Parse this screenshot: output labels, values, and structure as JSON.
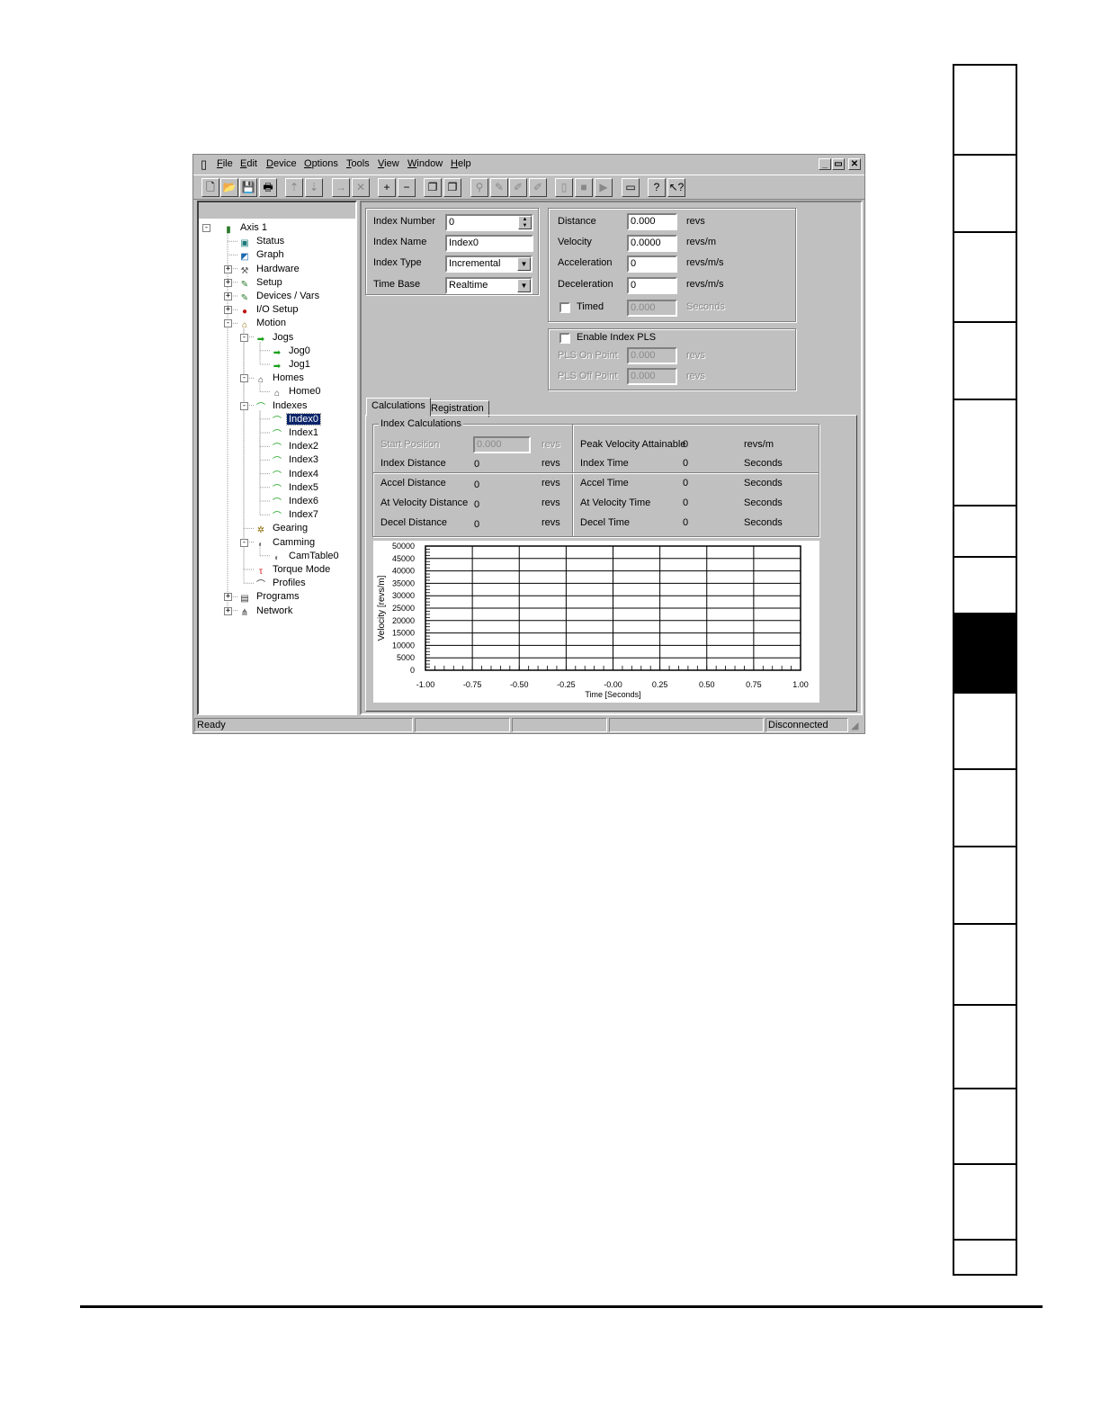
{
  "menu": {
    "items": [
      {
        "label": "File",
        "u": "F",
        "rest": "ile"
      },
      {
        "label": "Edit",
        "u": "E",
        "rest": "dit"
      },
      {
        "label": "Device",
        "u": "D",
        "rest": "evice"
      },
      {
        "label": "Options",
        "u": "O",
        "rest": "ptions"
      },
      {
        "label": "Tools",
        "u": "T",
        "rest": "ools"
      },
      {
        "label": "View",
        "u": "V",
        "rest": "iew"
      },
      {
        "label": "Window",
        "u": "W",
        "rest": "indow"
      },
      {
        "label": "Help",
        "u": "H",
        "rest": "elp"
      }
    ],
    "win_minimize": "_",
    "win_restore": "▭",
    "win_close": "✕"
  },
  "tree": {
    "nodes": [
      {
        "name": "tree-axis1",
        "label": "Axis 1",
        "icon": "axis-icon",
        "glyph": "▮",
        "color": "#2a7a2a"
      },
      {
        "name": "tree-status",
        "label": "Status",
        "icon": "status-icon",
        "glyph": "▣",
        "color": "#1d7a7a"
      },
      {
        "name": "tree-graph",
        "label": "Graph",
        "icon": "graph-icon",
        "glyph": "◩",
        "color": "#1d6ab0"
      },
      {
        "name": "tree-hardware",
        "label": "Hardware",
        "icon": "hardware-icon",
        "glyph": "⚒",
        "color": "#555"
      },
      {
        "name": "tree-setup",
        "label": "Setup",
        "icon": "setup-icon",
        "glyph": "✎",
        "color": "#2a7a2a"
      },
      {
        "name": "tree-devices-vars",
        "label": "Devices / Vars",
        "icon": "devices-icon",
        "glyph": "✎",
        "color": "#2a7a2a"
      },
      {
        "name": "tree-io-setup",
        "label": "I/O Setup",
        "icon": "io-setup-icon",
        "glyph": "●",
        "color": "#c01818"
      },
      {
        "name": "tree-motion",
        "label": "Motion",
        "icon": "motion-icon",
        "glyph": "⌂",
        "color": "#8a6a00"
      },
      {
        "name": "tree-jogs",
        "label": "Jogs",
        "icon": "jogs-icon",
        "glyph": "➡",
        "color": "#18a018"
      },
      {
        "name": "tree-jog0",
        "label": "Jog0",
        "icon": "jog-arrow-icon",
        "glyph": "➡",
        "color": "#18a018"
      },
      {
        "name": "tree-jog1",
        "label": "Jog1",
        "icon": "jog-arrow-icon",
        "glyph": "➡",
        "color": "#18a018"
      },
      {
        "name": "tree-homes",
        "label": "Homes",
        "icon": "home-icon",
        "glyph": "⌂",
        "color": "#333"
      },
      {
        "name": "tree-home0",
        "label": "Home0",
        "icon": "home-icon",
        "glyph": "⌂",
        "color": "#333"
      },
      {
        "name": "tree-indexes",
        "label": "Indexes",
        "icon": "index-profile-icon",
        "glyph": "⌒",
        "color": "#18a018"
      },
      {
        "name": "tree-index0",
        "label": "Index0",
        "icon": "index-profile-icon",
        "glyph": "⌒",
        "color": "#18a018"
      },
      {
        "name": "tree-index1",
        "label": "Index1",
        "icon": "index-profile-icon",
        "glyph": "⌒",
        "color": "#18a018"
      },
      {
        "name": "tree-index2",
        "label": "Index2",
        "icon": "index-profile-icon",
        "glyph": "⌒",
        "color": "#18a018"
      },
      {
        "name": "tree-index3",
        "label": "Index3",
        "icon": "index-profile-icon",
        "glyph": "⌒",
        "color": "#18a018"
      },
      {
        "name": "tree-index4",
        "label": "Index4",
        "icon": "index-profile-icon",
        "glyph": "⌒",
        "color": "#18a018"
      },
      {
        "name": "tree-index5",
        "label": "Index5",
        "icon": "index-profile-icon",
        "glyph": "⌒",
        "color": "#18a018"
      },
      {
        "name": "tree-index6",
        "label": "Index6",
        "icon": "index-profile-icon",
        "glyph": "⌒",
        "color": "#18a018"
      },
      {
        "name": "tree-index7",
        "label": "Index7",
        "icon": "index-profile-icon",
        "glyph": "⌒",
        "color": "#18a018"
      },
      {
        "name": "tree-gearing",
        "label": "Gearing",
        "icon": "gearing-icon",
        "glyph": "✲",
        "color": "#8a6a00"
      },
      {
        "name": "tree-camming",
        "label": "Camming",
        "icon": "camming-icon",
        "glyph": "◐",
        "color": "#777"
      },
      {
        "name": "tree-camtable0",
        "label": "CamTable0",
        "icon": "camtable-icon",
        "glyph": "◐",
        "color": "#777"
      },
      {
        "name": "tree-torque-mode",
        "label": "Torque Mode",
        "icon": "torque-icon",
        "glyph": "τ",
        "color": "#d01818"
      },
      {
        "name": "tree-profiles",
        "label": "Profiles",
        "icon": "profiles-icon",
        "glyph": "⌒",
        "color": "#333"
      },
      {
        "name": "tree-programs",
        "label": "Programs",
        "icon": "programs-icon",
        "glyph": "▤",
        "color": "#333"
      },
      {
        "name": "tree-network",
        "label": "Network",
        "icon": "network-icon",
        "glyph": "⋔",
        "color": "#333"
      }
    ],
    "selected": "Index0"
  },
  "index": {
    "number_label": "Index Number",
    "number_value": "0",
    "name_label": "Index Name",
    "name_value": "Index0",
    "type_label": "Index Type",
    "type_value": "Incremental",
    "timebase_label": "Time Base",
    "timebase_value": "Realtime"
  },
  "motion": {
    "distance_label": "Distance",
    "distance_value": "0.000",
    "distance_unit": "revs",
    "velocity_label": "Velocity",
    "velocity_value": "0.0000",
    "velocity_unit": "revs/m",
    "accel_label": "Acceleration",
    "accel_value": "0",
    "accel_unit": "revs/m/s",
    "decel_label": "Deceleration",
    "decel_value": "0",
    "decel_unit": "revs/m/s",
    "timed_label": "Timed",
    "timed_value": "0.000",
    "timed_unit": "Seconds"
  },
  "pls": {
    "enable_label": "Enable Index PLS",
    "on_label": "PLS On Point",
    "on_value": "0.000",
    "on_unit": "revs",
    "off_label": "PLS Off Point",
    "off_value": "0.000",
    "off_unit": "revs"
  },
  "tabs": {
    "calculations": "Calculations",
    "registration": "Registration"
  },
  "calc": {
    "group_title": "Index Calculations",
    "start_label": "Start Position",
    "start_value": "0.000",
    "start_unit": "revs",
    "index_dist_label": "Index Distance",
    "index_dist_value": "0",
    "index_dist_unit": "revs",
    "accel_dist_label": "Accel Distance",
    "accel_dist_value": "0",
    "accel_dist_unit": "revs",
    "atvel_dist_label": "At Velocity Distance",
    "atvel_dist_value": "0",
    "atvel_dist_unit": "revs",
    "decel_dist_label": "Decel Distance",
    "decel_dist_value": "0",
    "decel_dist_unit": "revs",
    "peak_label": "Peak Velocity Attainable",
    "peak_value": "0",
    "peak_unit": "revs/m",
    "index_time_label": "Index Time",
    "index_time_value": "0",
    "index_time_unit": "Seconds",
    "accel_time_label": "Accel Time",
    "accel_time_value": "0",
    "accel_time_unit": "Seconds",
    "atvel_time_label": "At Velocity Time",
    "atvel_time_value": "0",
    "atvel_time_unit": "Seconds",
    "decel_time_label": "Decel Time",
    "decel_time_value": "0",
    "decel_time_unit": "Seconds"
  },
  "chart_data": {
    "type": "line",
    "xlabel": "Time [Seconds]",
    "ylabel": "Velocity [revs/m]",
    "xlim": [
      -1.0,
      1.0
    ],
    "ylim": [
      0,
      50000
    ],
    "x_ticks": [
      "-1.00",
      "-0.75",
      "-0.50",
      "-0.25",
      "-0.00",
      "0.25",
      "0.50",
      "0.75",
      "1.00"
    ],
    "y_ticks": [
      "50000",
      "45000",
      "40000",
      "35000",
      "30000",
      "25000",
      "20000",
      "15000",
      "10000",
      "5000",
      "0"
    ],
    "grid": true,
    "series": []
  },
  "status": {
    "ready": "Ready",
    "connection": "Disconnected"
  },
  "toolbar": {
    "buttons": [
      {
        "name": "new-file-button",
        "glyph": "🗋"
      },
      {
        "name": "open-file-button",
        "glyph": "📂"
      },
      {
        "name": "save-button",
        "glyph": "💾"
      },
      {
        "name": "print-button",
        "glyph": "🖶"
      },
      {
        "name": "upload-button",
        "glyph": "⇡"
      },
      {
        "name": "download-button",
        "glyph": "⇣"
      },
      {
        "name": "insert-button",
        "glyph": "→"
      },
      {
        "name": "delete-button",
        "glyph": "✕"
      },
      {
        "name": "add-button",
        "glyph": "+"
      },
      {
        "name": "remove-button",
        "glyph": "−"
      },
      {
        "name": "copy-button",
        "glyph": "❐"
      },
      {
        "name": "paste-button",
        "glyph": "❐"
      },
      {
        "name": "search-button",
        "glyph": "⚲"
      },
      {
        "name": "edit-button",
        "glyph": "✎"
      },
      {
        "name": "tool-a-button",
        "glyph": "✐"
      },
      {
        "name": "tool-b-button",
        "glyph": "✐"
      },
      {
        "name": "run-button",
        "glyph": "▯"
      },
      {
        "name": "stop-button",
        "glyph": "■"
      },
      {
        "name": "step-button",
        "glyph": "▶"
      },
      {
        "name": "window-button",
        "glyph": "▭"
      },
      {
        "name": "help-button",
        "glyph": "?"
      },
      {
        "name": "context-help-button",
        "glyph": "↖?"
      }
    ]
  }
}
